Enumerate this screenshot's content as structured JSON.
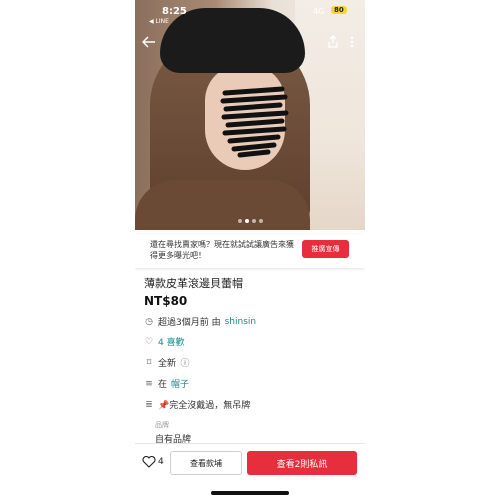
{
  "status_bar": {
    "time": "8:25",
    "source_app": "◀ LINE",
    "network": "4G",
    "battery": "80"
  },
  "hero": {
    "image_count": 4,
    "active_index": 1
  },
  "ad": {
    "message": "還在尋找賣家嗎？現在就試試讓廣告來獲得更多曝光吧！",
    "button": "推廣宣傳"
  },
  "product": {
    "title": "薄款皮革滾邊貝蕾帽",
    "price": "NT$80",
    "posted": "超過3個月前 由",
    "seller": "shinsin",
    "likes": "4 喜歡",
    "condition": "全新",
    "category_prefix": "在",
    "category": "帽子",
    "description": "📌完全沒戴過，無吊牌",
    "brand_label": "品牌",
    "brand": "自有品牌"
  },
  "bottom_bar": {
    "like_count": "4",
    "view_options": "查看款埔",
    "message_button": "查看2則私訊"
  }
}
